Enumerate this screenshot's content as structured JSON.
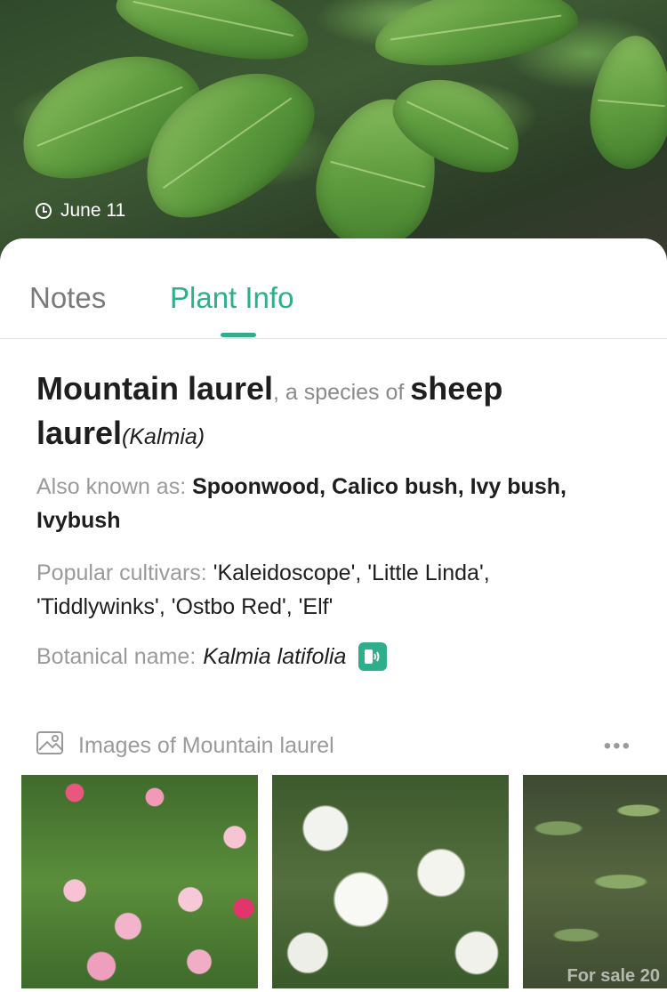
{
  "hero": {
    "date": "June 11"
  },
  "tabs": [
    {
      "label": "Notes"
    },
    {
      "label": "Plant Info"
    }
  ],
  "plant": {
    "common_name": "Mountain laurel",
    "species_connector": ", a species of ",
    "genus_common": "sheep laurel",
    "genus_scientific": "(Kalmia)",
    "aka_label": "Also known as: ",
    "aka_values": "Spoonwood, Calico bush, Ivy bush, Ivybush",
    "cultivars_label": "Popular cultivars: ",
    "cultivars_values": "'Kaleidoscope', 'Little Linda', 'Tiddlywinks', 'Ostbo Red', 'Elf'",
    "botanical_label": "Botanical name:",
    "botanical_value": "Kalmia latifolia"
  },
  "images": {
    "title": "Images of Mountain laurel",
    "more": "•••",
    "watermark": "For sale 20"
  },
  "colors": {
    "accent": "#2fae8c"
  }
}
